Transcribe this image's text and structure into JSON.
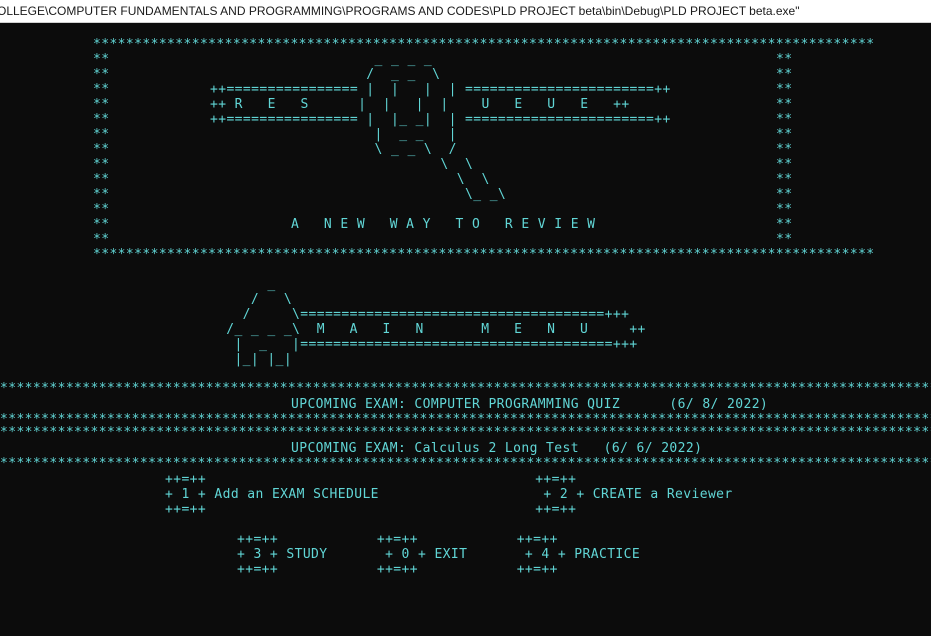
{
  "window": {
    "title": "OLLEGE\\COMPUTER FUNDAMENTALS AND PROGRAMMING\\PROGRAMS AND CODES\\PLD PROJECT beta\\bin\\Debug\\PLD PROJECT beta.exe\""
  },
  "console": {
    "text_color": "#61d6d6",
    "background": "#0c0c0c",
    "banner": {
      "border": "***********************************************************************************************",
      "side": "**",
      "logo": [
        "                    _ _ _ _",
        "                   /  _ _  \\",
        "++================ |  |   |  | =======================++",
        "++ R   E   S      |  |   |  |    U   E   U   E   ++",
        "++================ |  |_ _|  | =======================++",
        "                    |  _ _   |",
        "                    \\ _ _ \\  /",
        "                            \\  \\",
        "                              \\  \\",
        "                               \\_ _\\"
      ],
      "tagline": "A   N E W   W A Y   T O   R E V I E W"
    },
    "menu_header": [
      "      _",
      "    /   \\",
      "   /     \\=====================================+++",
      " /_ _ _ _\\  M   A   I   N       M   E   N   U     ++",
      "  |  _   |======================================+++",
      "  |_| |_|"
    ],
    "exam_sep": "*********************************************************************************************************************************",
    "exams": [
      "UPCOMING EXAM: COMPUTER PROGRAMMING QUIZ      (6/ 8/ 2022)",
      "UPCOMING EXAM: Calculus 2 Long Test   (6/ 6/ 2022)"
    ],
    "options_row1": {
      "top": "++=++                                        ++=++",
      "mid": "+ 1 + Add an EXAM SCHEDULE                    + 2 + CREATE a Reviewer",
      "bot": "++=++                                        ++=++"
    },
    "options_row2": {
      "top": "++=++            ++=++            ++=++",
      "mid": "+ 3 + STUDY       + 0 + EXIT       + 4 + PRACTICE",
      "bot": "++=++            ++=++            ++=++"
    }
  }
}
